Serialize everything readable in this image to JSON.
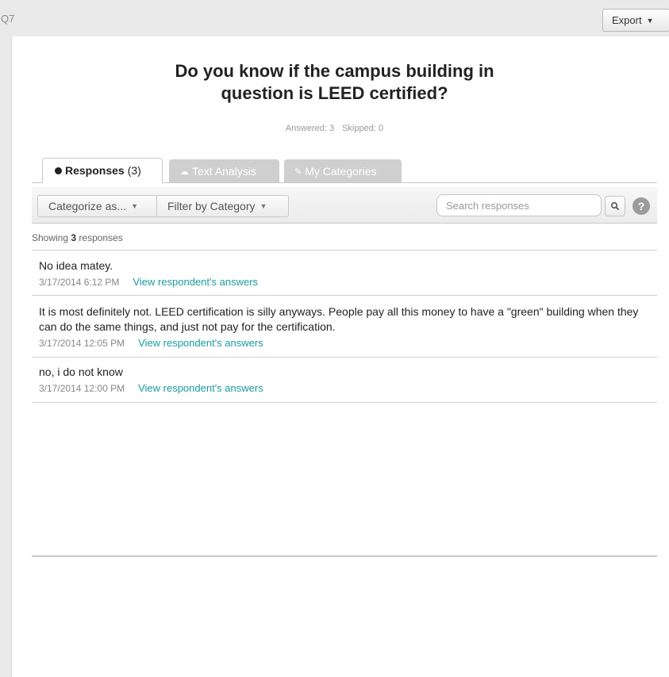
{
  "header": {
    "question_number": "Q7",
    "export_label": "Export"
  },
  "question": {
    "title_line1": "Do you know if the campus building in",
    "title_line2": "question is LEED certified?"
  },
  "stats": {
    "answered": "Answered: 3",
    "skipped": "Skipped: 0"
  },
  "tabs": [
    {
      "label": "Responses",
      "count": "(3)",
      "icon": "dot-icon"
    },
    {
      "label": "Text Analysis",
      "icon": "cloud-icon"
    },
    {
      "label": "My Categories",
      "icon": "tag-icon"
    }
  ],
  "toolbar": {
    "categorize_label": "Categorize as...",
    "filter_label": "Filter by Category",
    "search_placeholder": "Search responses"
  },
  "summary": {
    "prefix": "Showing",
    "count": "3",
    "suffix": "responses"
  },
  "responses": [
    {
      "text": "No idea matey.",
      "date": "3/17/2014 6:12 PM",
      "link": "View respondent's answers"
    },
    {
      "text": "It is most definitely not. LEED certification is silly anyways. People pay all this money to have a \"green\" building when they can do the same things, and just not pay for the certification.",
      "date": "3/17/2014 12:05 PM",
      "link": "View respondent's answers"
    },
    {
      "text": "no, i do not know",
      "date": "3/17/2014 12:00 PM",
      "link": "View respondent's answers"
    }
  ],
  "colors": {
    "link": "#1a9aa0",
    "tab_inactive": "#cfcfcf",
    "background": "#e9e9e9"
  }
}
